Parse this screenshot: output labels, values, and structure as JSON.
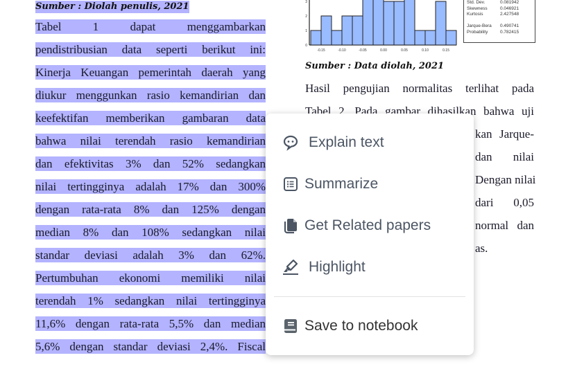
{
  "document": {
    "left_caption": "Sumber : Diolah penulis, 2021",
    "left_lines": [
      "Tabel 1 dapat menggambarkan",
      "pendistribusian data seperti berikut ini:",
      "Kinerja Keuangan pemerintah daerah yang",
      "diukur menggunkan rasio kemandirian dan",
      "keefektifan memberikan gambaran data",
      "bahwa nilai terendah rasio kemandirian",
      "dan efektivitas 3% dan 52% sedangkan",
      "nilai tertingginya adalah 17% dan 300%",
      "dengan rata-rata 8% dan 125% dengan",
      "median 8% dan 108% sedangkan nilai",
      "standar deviasi adalah 3% dan 62%.",
      "Pertumbuhan ekonomi memiliki nilai",
      "terendah 1% sedangkan nilai tertingginya",
      "11,6% dengan rata-rata 5,5% dan median",
      "5,6% dengan standar deviasi 2,4%. Fiscal"
    ],
    "right_caption": "Sumber : Data diolah, 2021",
    "right_lines": [
      "Hasil pengujian normalitas terlihat pada",
      "Tabel 2. Pada gambar dihasilkan bahwa uji",
      "kan Jarque-",
      "dan nilai",
      "Dengan nilai",
      "dari 0,05",
      "normal dan",
      "as."
    ],
    "stats": [
      {
        "label": "Std. Dev.",
        "value": "0.081942"
      },
      {
        "label": "Skewness",
        "value": "0.046921"
      },
      {
        "label": "Kurtosis",
        "value": "2.427548"
      },
      {
        "label": "",
        "value": ""
      },
      {
        "label": "Jarque-Bera",
        "value": "0.490741"
      },
      {
        "label": "Probability",
        "value": "0.782415"
      }
    ]
  },
  "chart_data": {
    "type": "bar",
    "title": "",
    "xlabel": "",
    "ylabel": "",
    "x_ticks": [
      "-0.15",
      "-0.10",
      "-0.05",
      "0.00",
      "0.05",
      "0.10",
      "0.15"
    ],
    "y_ticks": [
      "0",
      "1",
      "2",
      "3"
    ],
    "values": [
      1,
      2,
      1,
      2,
      2,
      4,
      4,
      3,
      3,
      4,
      1,
      1,
      3,
      1
    ],
    "ylim": [
      0,
      3.5
    ],
    "bar_color": "#99bbff"
  },
  "context_menu": {
    "items": [
      {
        "label": "Explain text",
        "icon": "chat-bubble-icon"
      },
      {
        "label": "Summarize",
        "icon": "list-icon"
      },
      {
        "label": "Get Related papers",
        "icon": "documents-icon"
      },
      {
        "label": "Highlight",
        "icon": "highlighter-icon"
      },
      {
        "label": "Save to notebook",
        "icon": "notebook-icon"
      }
    ]
  }
}
